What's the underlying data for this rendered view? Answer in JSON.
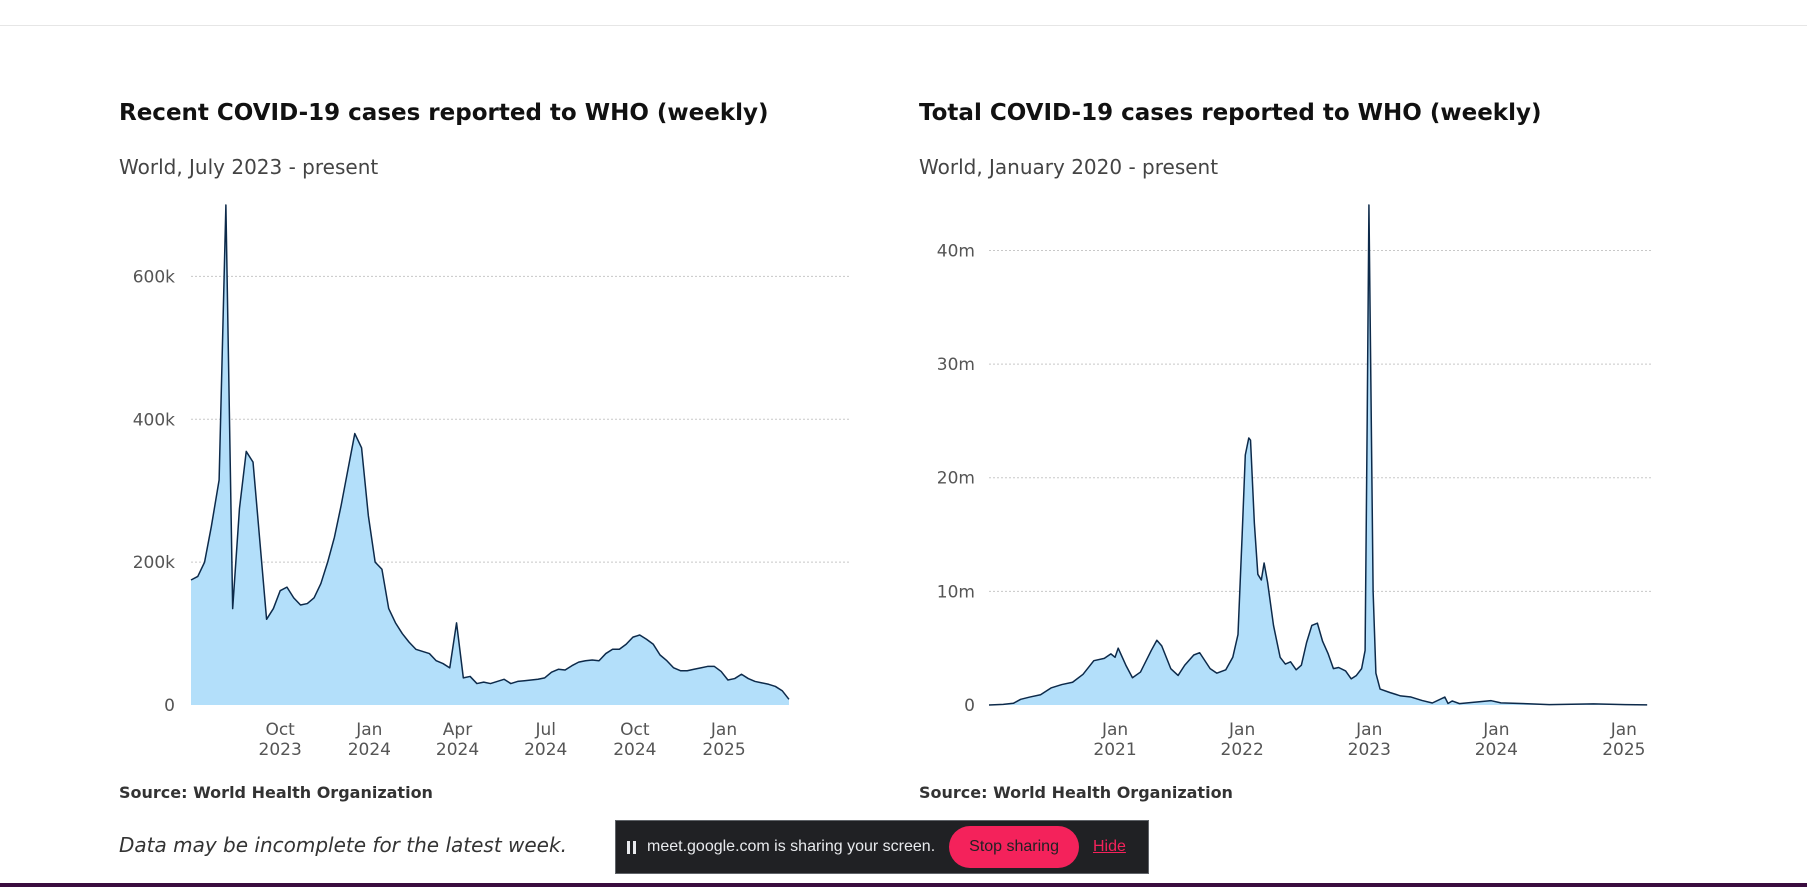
{
  "charts": [
    {
      "title": "Recent COVID-19 cases reported to WHO (weekly)",
      "subtitle": "World, July 2023 - present",
      "source": "Source: World Health Organization",
      "note": "Data may be incomplete for the latest week."
    },
    {
      "title": "Total COVID-19 cases reported to WHO (weekly)",
      "subtitle": "World, January 2020 - present",
      "source": "Source: World Health Organization",
      "note": ""
    }
  ],
  "share_bar": {
    "message": "meet.google.com is sharing your screen.",
    "stop_label": "Stop sharing",
    "hide_label": "Hide"
  },
  "colors": {
    "area_fill": "#b3dffa",
    "area_line": "#0d2a4a",
    "stop_button": "#f4225b",
    "share_bar_bg": "#202124"
  },
  "chart_data": [
    {
      "type": "area",
      "title": "Recent COVID-19 cases reported to WHO (weekly)",
      "subtitle": "World, July 2023 - present",
      "xlabel": "",
      "ylabel": "",
      "x_range": [
        "2023-07-01",
        "2025-05-12"
      ],
      "ylim": [
        0,
        700000
      ],
      "y_ticks": [
        0,
        200000,
        400000,
        600000
      ],
      "y_tick_labels": [
        "0",
        "200k",
        "400k",
        "600k"
      ],
      "x_ticks": [
        {
          "date": "2023-10-01",
          "label": [
            "Oct",
            "2023"
          ]
        },
        {
          "date": "2024-01-01",
          "label": [
            "Jan",
            "2024"
          ]
        },
        {
          "date": "2024-04-01",
          "label": [
            "Apr",
            "2024"
          ]
        },
        {
          "date": "2024-07-01",
          "label": [
            "Jul",
            "2024"
          ]
        },
        {
          "date": "2024-10-01",
          "label": [
            "Oct",
            "2024"
          ]
        },
        {
          "date": "2025-01-01",
          "label": [
            "Jan",
            "2025"
          ]
        }
      ],
      "grid": true,
      "series": [
        {
          "points": [
            [
              "2023-07-01",
              175000
            ],
            [
              "2023-07-08",
              180000
            ],
            [
              "2023-07-15",
              200000
            ],
            [
              "2023-07-22",
              250000
            ],
            [
              "2023-07-30",
              315000
            ],
            [
              "2023-08-06",
              700000
            ],
            [
              "2023-08-13",
              135000
            ],
            [
              "2023-08-20",
              275000
            ],
            [
              "2023-08-27",
              355000
            ],
            [
              "2023-09-03",
              340000
            ],
            [
              "2023-09-10",
              230000
            ],
            [
              "2023-09-17",
              120000
            ],
            [
              "2023-09-24",
              135000
            ],
            [
              "2023-10-01",
              160000
            ],
            [
              "2023-10-08",
              165000
            ],
            [
              "2023-10-15",
              150000
            ],
            [
              "2023-10-22",
              140000
            ],
            [
              "2023-10-29",
              142000
            ],
            [
              "2023-11-05",
              150000
            ],
            [
              "2023-11-12",
              170000
            ],
            [
              "2023-11-19",
              200000
            ],
            [
              "2023-11-26",
              235000
            ],
            [
              "2023-12-03",
              280000
            ],
            [
              "2023-12-10",
              330000
            ],
            [
              "2023-12-17",
              380000
            ],
            [
              "2023-12-24",
              360000
            ],
            [
              "2023-12-31",
              265000
            ],
            [
              "2024-01-07",
              200000
            ],
            [
              "2024-01-14",
              190000
            ],
            [
              "2024-01-21",
              135000
            ],
            [
              "2024-01-28",
              115000
            ],
            [
              "2024-02-04",
              100000
            ],
            [
              "2024-02-11",
              88000
            ],
            [
              "2024-02-18",
              78000
            ],
            [
              "2024-02-25",
              75000
            ],
            [
              "2024-03-03",
              72000
            ],
            [
              "2024-03-10",
              62000
            ],
            [
              "2024-03-17",
              58000
            ],
            [
              "2024-03-24",
              52000
            ],
            [
              "2024-03-31",
              115000
            ],
            [
              "2024-04-07",
              38000
            ],
            [
              "2024-04-14",
              40000
            ],
            [
              "2024-04-21",
              30000
            ],
            [
              "2024-04-28",
              32000
            ],
            [
              "2024-05-05",
              30000
            ],
            [
              "2024-05-12",
              33000
            ],
            [
              "2024-05-19",
              36000
            ],
            [
              "2024-05-26",
              30000
            ],
            [
              "2024-06-02",
              33000
            ],
            [
              "2024-06-09",
              34000
            ],
            [
              "2024-06-16",
              35000
            ],
            [
              "2024-06-23",
              36000
            ],
            [
              "2024-06-30",
              38000
            ],
            [
              "2024-07-07",
              46000
            ],
            [
              "2024-07-14",
              50000
            ],
            [
              "2024-07-21",
              49000
            ],
            [
              "2024-07-28",
              55000
            ],
            [
              "2024-08-04",
              60000
            ],
            [
              "2024-08-11",
              62000
            ],
            [
              "2024-08-18",
              63000
            ],
            [
              "2024-08-25",
              62000
            ],
            [
              "2024-09-01",
              72000
            ],
            [
              "2024-09-08",
              78000
            ],
            [
              "2024-09-15",
              78000
            ],
            [
              "2024-09-22",
              85000
            ],
            [
              "2024-09-29",
              95000
            ],
            [
              "2024-10-06",
              98000
            ],
            [
              "2024-10-13",
              92000
            ],
            [
              "2024-10-20",
              85000
            ],
            [
              "2024-10-27",
              70000
            ],
            [
              "2024-11-03",
              62000
            ],
            [
              "2024-11-10",
              52000
            ],
            [
              "2024-11-17",
              48000
            ],
            [
              "2024-11-24",
              48000
            ],
            [
              "2024-12-01",
              50000
            ],
            [
              "2024-12-08",
              52000
            ],
            [
              "2024-12-15",
              54000
            ],
            [
              "2024-12-22",
              54000
            ],
            [
              "2024-12-29",
              47000
            ],
            [
              "2025-01-05",
              35000
            ],
            [
              "2025-01-12",
              37000
            ],
            [
              "2025-01-19",
              43000
            ],
            [
              "2025-01-26",
              37000
            ],
            [
              "2025-02-02",
              33000
            ],
            [
              "2025-02-09",
              31000
            ],
            [
              "2025-02-16",
              29000
            ],
            [
              "2025-02-23",
              26000
            ],
            [
              "2025-03-02",
              20000
            ],
            [
              "2025-03-09",
              8000
            ]
          ]
        }
      ]
    },
    {
      "type": "area",
      "title": "Total COVID-19 cases reported to WHO (weekly)",
      "subtitle": "World, January 2020 - present",
      "xlabel": "",
      "ylabel": "",
      "x_range": [
        "2020-01-05",
        "2025-03-20"
      ],
      "ylim": [
        0,
        44000000
      ],
      "y_ticks": [
        0,
        10000000,
        20000000,
        30000000,
        40000000
      ],
      "y_tick_labels": [
        "0",
        "10m",
        "20m",
        "30m",
        "40m"
      ],
      "x_ticks": [
        {
          "date": "2021-01-01",
          "label": [
            "Jan",
            "2021"
          ]
        },
        {
          "date": "2022-01-01",
          "label": [
            "Jan",
            "2022"
          ]
        },
        {
          "date": "2023-01-01",
          "label": [
            "Jan",
            "2023"
          ]
        },
        {
          "date": "2024-01-01",
          "label": [
            "Jan",
            "2024"
          ]
        },
        {
          "date": "2025-01-01",
          "label": [
            "Jan",
            "2025"
          ]
        }
      ],
      "grid": true,
      "series": [
        {
          "points": [
            [
              "2020-01-05",
              0
            ],
            [
              "2020-02-15",
              50000
            ],
            [
              "2020-03-15",
              150000
            ],
            [
              "2020-04-05",
              500000
            ],
            [
              "2020-05-01",
              700000
            ],
            [
              "2020-06-01",
              900000
            ],
            [
              "2020-07-01",
              1500000
            ],
            [
              "2020-08-01",
              1800000
            ],
            [
              "2020-09-01",
              2000000
            ],
            [
              "2020-10-01",
              2700000
            ],
            [
              "2020-11-01",
              3900000
            ],
            [
              "2020-12-01",
              4100000
            ],
            [
              "2020-12-20",
              4500000
            ],
            [
              "2021-01-01",
              4200000
            ],
            [
              "2021-01-10",
              5000000
            ],
            [
              "2021-02-01",
              3500000
            ],
            [
              "2021-02-20",
              2400000
            ],
            [
              "2021-03-15",
              2900000
            ],
            [
              "2021-04-15",
              4800000
            ],
            [
              "2021-05-01",
              5700000
            ],
            [
              "2021-05-15",
              5200000
            ],
            [
              "2021-06-10",
              3200000
            ],
            [
              "2021-07-01",
              2600000
            ],
            [
              "2021-07-20",
              3500000
            ],
            [
              "2021-08-15",
              4400000
            ],
            [
              "2021-09-01",
              4600000
            ],
            [
              "2021-10-01",
              3200000
            ],
            [
              "2021-10-20",
              2800000
            ],
            [
              "2021-11-15",
              3100000
            ],
            [
              "2021-12-05",
              4200000
            ],
            [
              "2021-12-20",
              6200000
            ],
            [
              "2022-01-01",
              15000000
            ],
            [
              "2022-01-10",
              22000000
            ],
            [
              "2022-01-20",
              23500000
            ],
            [
              "2022-01-25",
              23300000
            ],
            [
              "2022-02-05",
              16000000
            ],
            [
              "2022-02-15",
              11500000
            ],
            [
              "2022-02-25",
              11000000
            ],
            [
              "2022-03-05",
              12500000
            ],
            [
              "2022-03-15",
              10800000
            ],
            [
              "2022-04-01",
              7000000
            ],
            [
              "2022-04-20",
              4200000
            ],
            [
              "2022-05-05",
              3600000
            ],
            [
              "2022-05-20",
              3800000
            ],
            [
              "2022-06-05",
              3100000
            ],
            [
              "2022-06-20",
              3500000
            ],
            [
              "2022-07-05",
              5500000
            ],
            [
              "2022-07-20",
              7000000
            ],
            [
              "2022-08-05",
              7200000
            ],
            [
              "2022-08-20",
              5600000
            ],
            [
              "2022-09-05",
              4500000
            ],
            [
              "2022-09-20",
              3200000
            ],
            [
              "2022-10-05",
              3300000
            ],
            [
              "2022-10-25",
              3000000
            ],
            [
              "2022-11-10",
              2300000
            ],
            [
              "2022-11-25",
              2600000
            ],
            [
              "2022-12-10",
              3200000
            ],
            [
              "2022-12-20",
              4800000
            ],
            [
              "2022-12-26",
              25000000
            ],
            [
              "2022-12-31",
              44000000
            ],
            [
              "2023-01-05",
              30000000
            ],
            [
              "2023-01-12",
              10000000
            ],
            [
              "2023-01-20",
              2800000
            ],
            [
              "2023-02-01",
              1400000
            ],
            [
              "2023-03-01",
              1100000
            ],
            [
              "2023-04-01",
              800000
            ],
            [
              "2023-05-01",
              700000
            ],
            [
              "2023-06-01",
              400000
            ],
            [
              "2023-07-01",
              175000
            ],
            [
              "2023-08-06",
              700000
            ],
            [
              "2023-08-15",
              135000
            ],
            [
              "2023-08-27",
              355000
            ],
            [
              "2023-09-17",
              120000
            ],
            [
              "2023-12-17",
              380000
            ],
            [
              "2024-01-14",
              190000
            ],
            [
              "2024-03-31",
              115000
            ],
            [
              "2024-06-01",
              30000
            ],
            [
              "2024-10-06",
              98000
            ],
            [
              "2025-01-05",
              35000
            ],
            [
              "2025-03-09",
              8000
            ]
          ]
        }
      ]
    }
  ]
}
